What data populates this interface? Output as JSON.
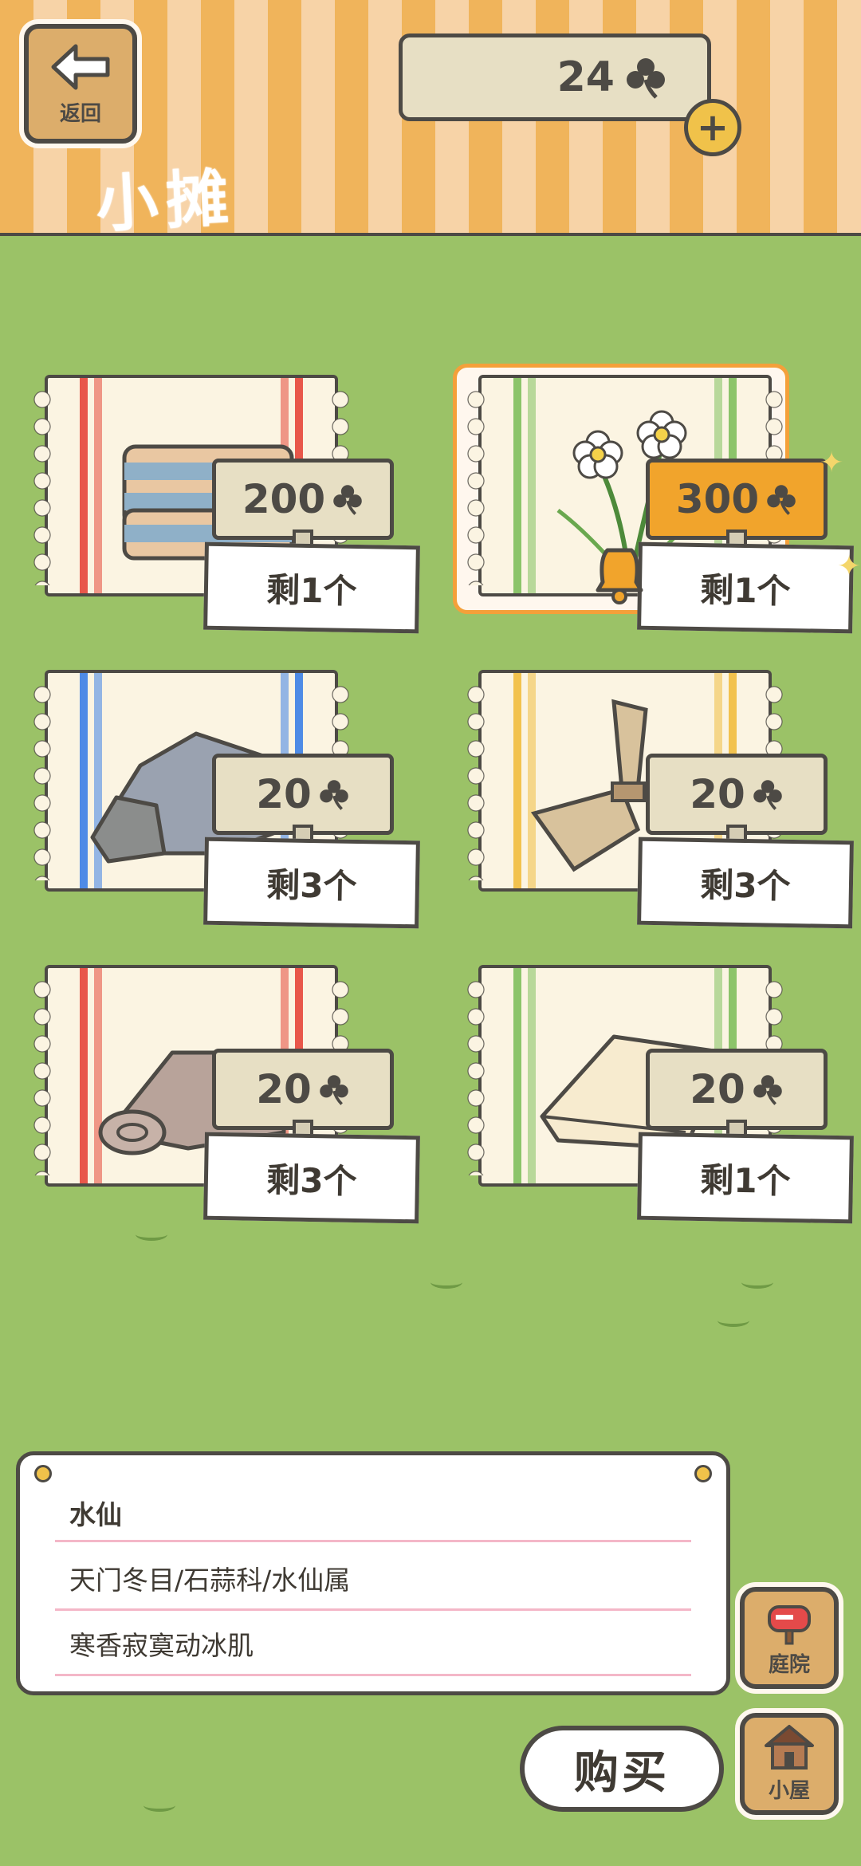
{
  "header": {
    "back_label": "返回",
    "title": "小摊",
    "currency": "24"
  },
  "items": [
    {
      "price": "200",
      "stock": "剩1个",
      "stripe_color": "#e8574a",
      "goods": "striped-blanket"
    },
    {
      "price": "300",
      "stock": "剩1个",
      "stripe_color": "#8cc46a",
      "goods": "narcissus",
      "selected": true
    },
    {
      "price": "20",
      "stock": "剩3个",
      "stripe_color": "#4e8be6",
      "goods": "stone"
    },
    {
      "price": "20",
      "stock": "剩3个",
      "stripe_color": "#f2c24e",
      "goods": "straw-bundle"
    },
    {
      "price": "20",
      "stock": "剩3个",
      "stripe_color": "#e8574a",
      "goods": "rolled-cloth"
    },
    {
      "price": "20",
      "stock": "剩1个",
      "stripe_color": "#8cc46a",
      "goods": "folded-cloth"
    }
  ],
  "info": {
    "name": "水仙",
    "taxonomy": "天门冬目/石蒜科/水仙属",
    "description": "寒香寂寞动冰肌"
  },
  "nav": {
    "yard_label": "庭院",
    "house_label": "小屋",
    "buy_label": "购买"
  }
}
